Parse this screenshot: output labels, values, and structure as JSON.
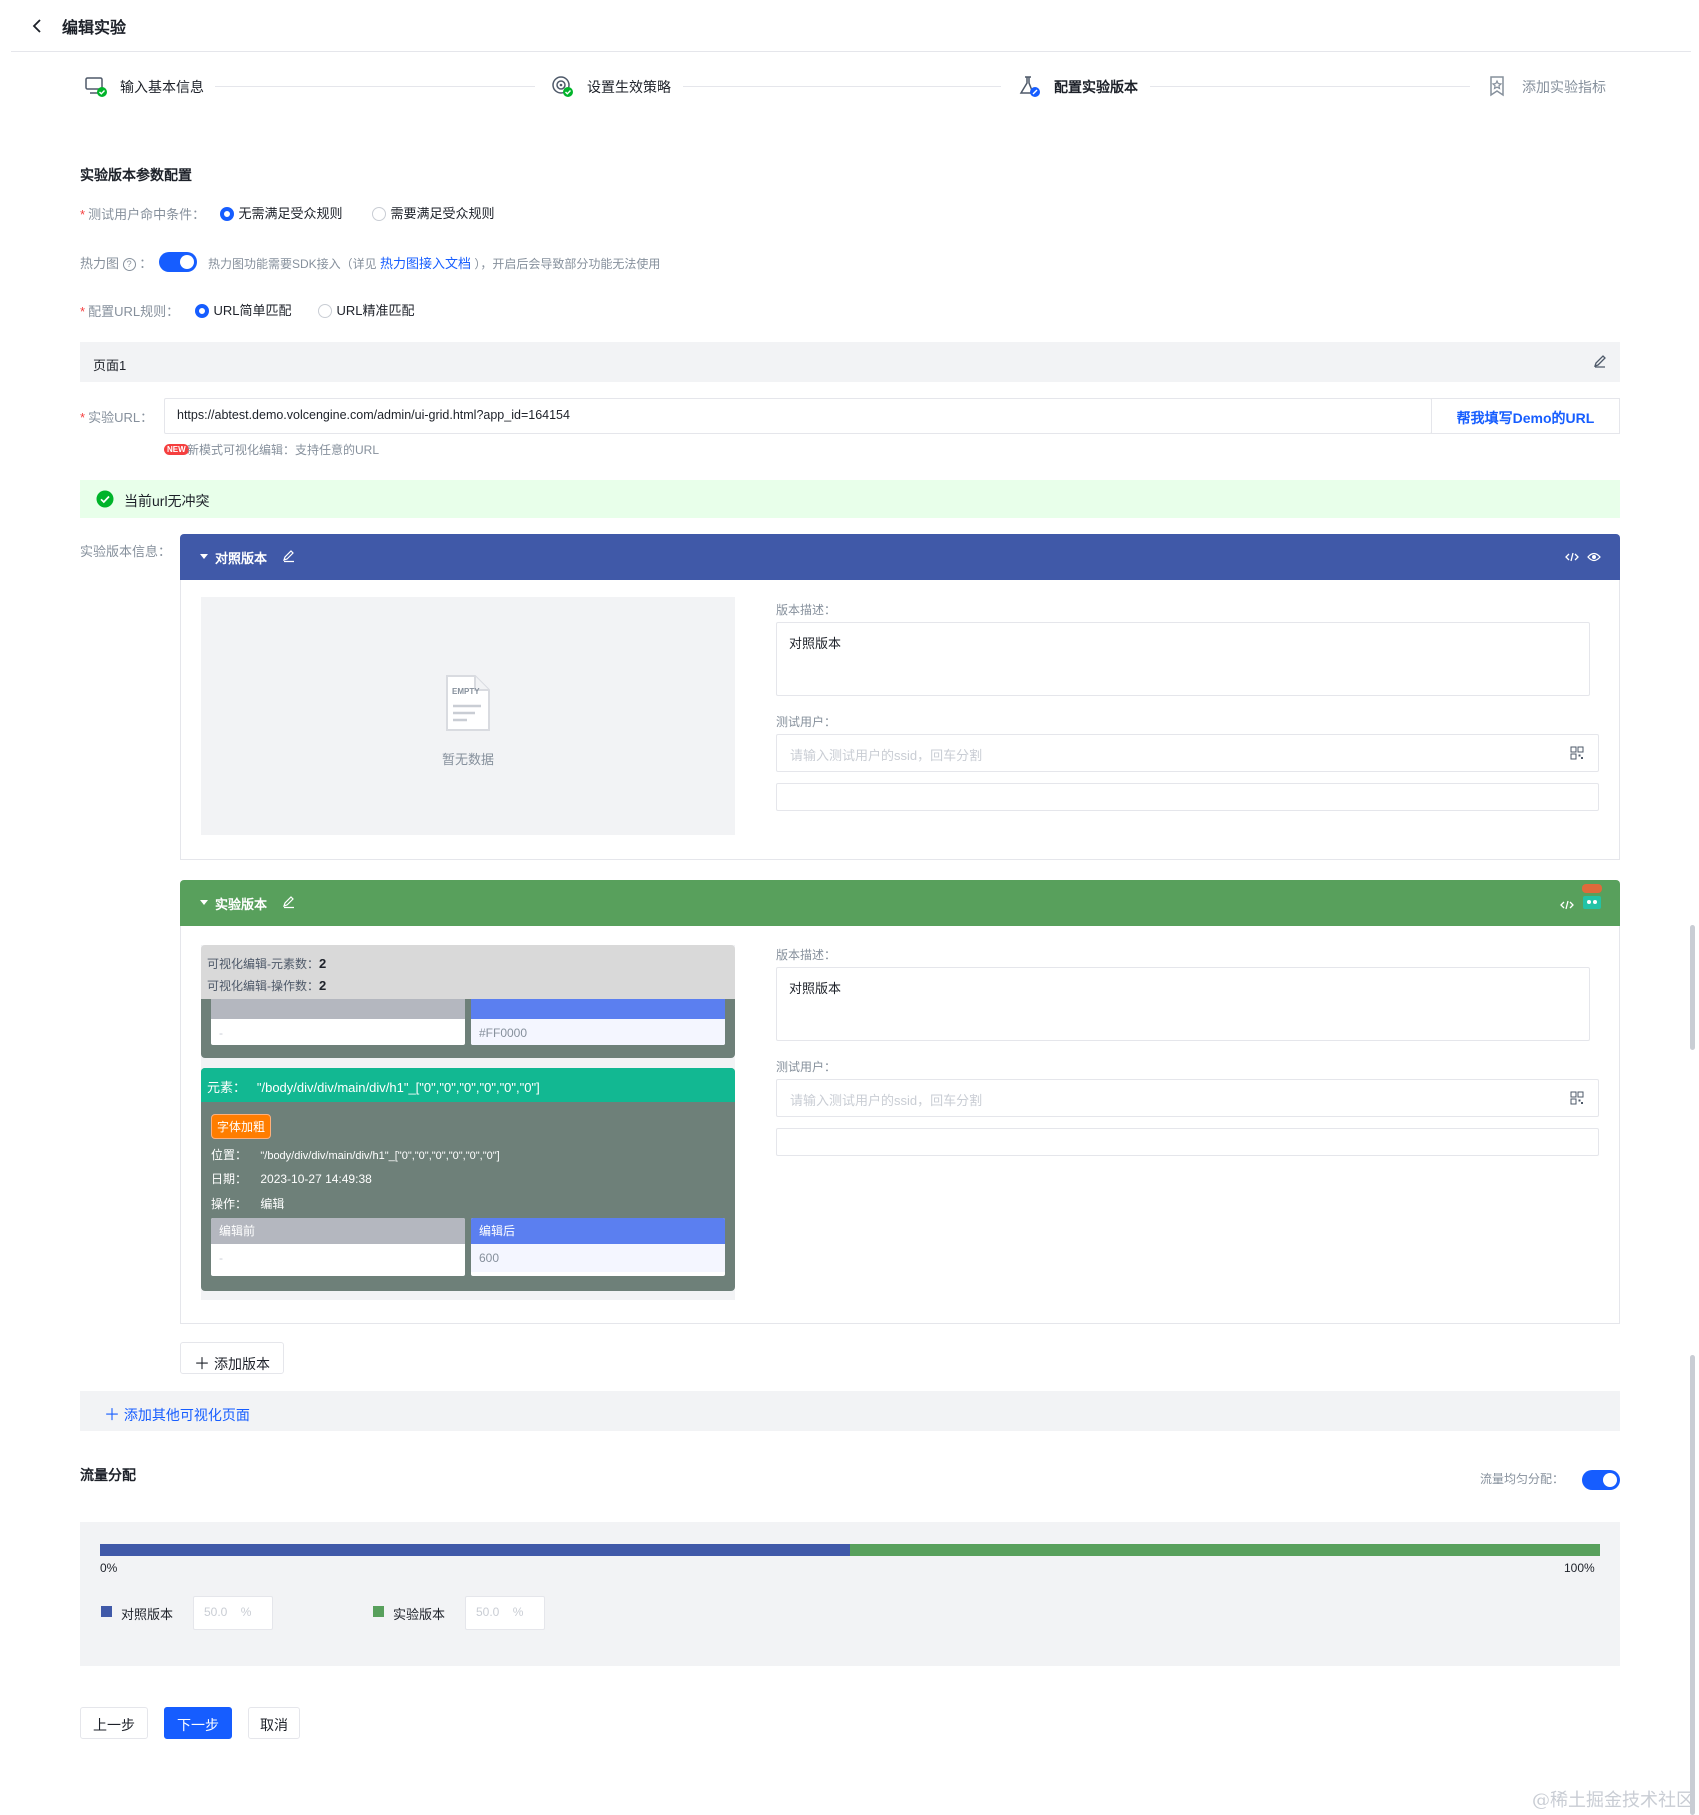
{
  "header": {
    "title": "编辑实验"
  },
  "steps": [
    {
      "label": "输入基本信息",
      "icon": "monitor-check-icon"
    },
    {
      "label": "设置生效策略",
      "icon": "target-check-icon"
    },
    {
      "label": "配置实验版本",
      "icon": "flask-icon"
    },
    {
      "label": "添加实验指标",
      "icon": "bookmark-star-icon"
    }
  ],
  "config": {
    "section_title": "实验版本参数配置",
    "hit_condition": {
      "label": "测试用户命中条件：",
      "options": [
        "无需满足受众规则",
        "需要满足受众规则"
      ],
      "selected": 0
    },
    "heatmap": {
      "label": "热力图",
      "on": true,
      "desc_prefix": "热力图功能需要SDK接入（详见",
      "link": "热力图接入文档",
      "desc_suffix": "），开启后会导致部分功能无法使用"
    },
    "url_rule": {
      "label": "配置URL规则：",
      "options": [
        "URL简单匹配",
        "URL精准匹配"
      ],
      "selected": 0
    }
  },
  "page": {
    "name": "页面1",
    "url_label": "实验URL：",
    "url_value": "https://abtest.demo.volcengine.com/admin/ui-grid.html?app_id=164154",
    "url_help_button": "帮我填写Demo的URL",
    "new_badge": "NEW",
    "new_hint": "新模式可视化编辑：支持任意的URL",
    "no_conflict": "当前url无冲突"
  },
  "versions": {
    "label": "实验版本信息：",
    "control": {
      "name": "对照版本",
      "color": "#4059a8",
      "empty_badge": "EMPTY",
      "empty_text": "暂无数据",
      "desc_label": "版本描述：",
      "desc_value": "对照版本",
      "users_label": "测试用户：",
      "users_placeholder": "请输入测试用户的ssid，回车分割"
    },
    "experiment": {
      "name": "实验版本",
      "color": "#58a05c",
      "stats": [
        {
          "label": "可视化编辑-元素数：",
          "value": "2"
        },
        {
          "label": "可视化编辑-操作数：",
          "value": "2"
        }
      ],
      "partial_card": {
        "before_value": "-",
        "after_value": "#FF0000"
      },
      "element": {
        "title_label": "元素：",
        "title_value": "\"/body/div/div/main/div/h1\"_[\"0\",\"0\",\"0\",\"0\",\"0\",\"0\"]",
        "tag": "字体加粗",
        "rows": [
          {
            "label": "位置：",
            "value": "\"/body/div/div/main/div/h1\"_[\"0\",\"0\",\"0\",\"0\",\"0\",\"0\"]"
          },
          {
            "label": "日期：",
            "value": "2023-10-27 14:49:38"
          },
          {
            "label": "操作：",
            "value": "编辑"
          }
        ],
        "before_label": "编辑前",
        "before_value": "-",
        "after_label": "编辑后",
        "after_value": "600"
      },
      "desc_label": "版本描述：",
      "desc_value": "对照版本",
      "users_label": "测试用户：",
      "users_placeholder": "请输入测试用户的ssid，回车分割"
    },
    "add_version": "添加版本",
    "add_page": "添加其他可视化页面"
  },
  "traffic": {
    "title": "流量分配",
    "even_label": "流量均匀分配：",
    "even_on": true,
    "min_label": "0%",
    "max_label": "100%",
    "split": [
      {
        "name": "对照版本",
        "value": "50.0",
        "unit": "%",
        "fraction": 0.5,
        "color": "#4059a8"
      },
      {
        "name": "实验版本",
        "value": "50.0",
        "unit": "%",
        "fraction": 0.5,
        "color": "#58a05c"
      }
    ]
  },
  "footer": {
    "prev": "上一步",
    "next": "下一步",
    "cancel": "取消"
  },
  "watermark": "@稀土掘金技术社区"
}
